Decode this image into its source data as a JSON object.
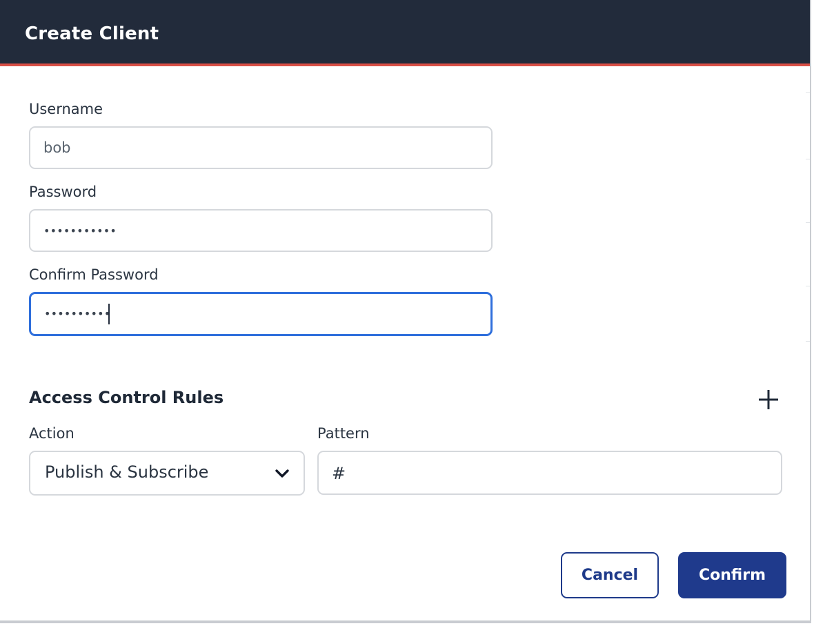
{
  "dialog": {
    "title": "Create Client"
  },
  "form": {
    "username": {
      "label": "Username",
      "value": "bob"
    },
    "password": {
      "label": "Password",
      "masked_value": "•••••••••••"
    },
    "confirm_password": {
      "label": "Confirm Password",
      "masked_value": "••••••••••"
    }
  },
  "acl": {
    "title": "Access Control Rules",
    "add_icon": "plus-icon",
    "action": {
      "label": "Action",
      "selected": "Publish & Subscribe",
      "icon": "chevron-down-icon"
    },
    "pattern": {
      "label": "Pattern",
      "value": "#"
    }
  },
  "buttons": {
    "cancel": "Cancel",
    "confirm": "Confirm"
  },
  "colors": {
    "header_bg": "#222b3b",
    "header_accent": "#d94f46",
    "focus_border": "#2f6fdc",
    "primary": "#1f3a8c"
  }
}
